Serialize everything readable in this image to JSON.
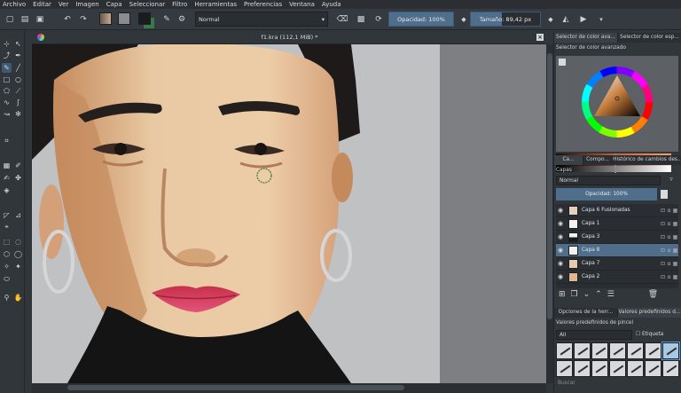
{
  "menu": [
    "Archivo",
    "Editar",
    "Ver",
    "Imagen",
    "Capa",
    "Seleccionar",
    "Filtro",
    "Herramientas",
    "Preferencias",
    "Ventana",
    "Ayuda"
  ],
  "toolbar": {
    "blend_mode": "Normal",
    "opacity": "Opacidad: 100%",
    "size": "Tamaño: 89,42 px"
  },
  "document": {
    "title": "f1.kra (112,1 MiB) *"
  },
  "dock": {
    "top_tabs": [
      "Selector de color ava...",
      "Selector de color esp..."
    ],
    "color_selector_title": "Selector de color avanzado",
    "mid_tabs": [
      "Ca...",
      "Compo...",
      "Histórico de cambios des..."
    ],
    "layers_title": "Capas",
    "layers_blend": "Normal",
    "layers_opacity": "Opacidad:  100%",
    "layers": [
      {
        "name": "Capa 6 Fusionadas",
        "selected": false
      },
      {
        "name": "Capa 1",
        "selected": false
      },
      {
        "name": "Capa 3",
        "selected": false
      },
      {
        "name": "Capa 8",
        "selected": true
      },
      {
        "name": "Capa 7",
        "selected": false
      },
      {
        "name": "Capa 2",
        "selected": false
      }
    ],
    "bottom_tabs": [
      "Opciones de la herr...",
      "Valores predefinidos d..."
    ],
    "presets_title": "Valores predefinidos de pincel",
    "presets_filter": "All",
    "presets_tag": "Etiqueta",
    "search_placeholder": "Buscar"
  },
  "colors": {
    "accent": "#4f6e8c",
    "panel": "#31363b"
  }
}
